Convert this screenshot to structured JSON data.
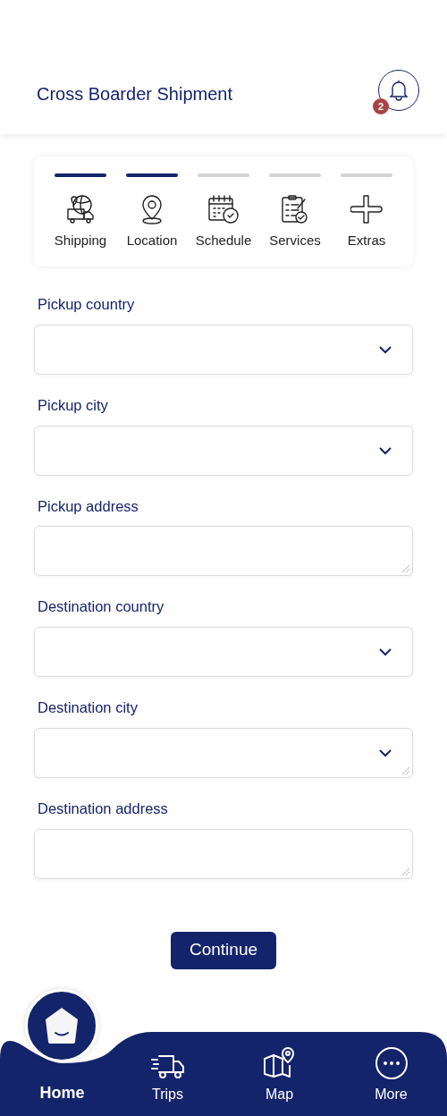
{
  "header": {
    "title": "Cross Boarder Shipment",
    "notification_count": "2"
  },
  "steps": [
    {
      "kind": "shipping",
      "label": "Shipping",
      "done": true
    },
    {
      "kind": "location",
      "label": "Location",
      "done": true
    },
    {
      "kind": "schedule",
      "label": "Schedule",
      "done": false
    },
    {
      "kind": "services",
      "label": "Services",
      "done": false
    },
    {
      "kind": "extras",
      "label": "Extras",
      "done": false
    }
  ],
  "fields": [
    {
      "kind": "select",
      "label": "Pickup country",
      "resizable": false
    },
    {
      "kind": "select",
      "label": "Pickup city",
      "resizable": false
    },
    {
      "kind": "textarea",
      "label": "Pickup address",
      "resizable": true
    },
    {
      "kind": "select",
      "label": "Destination country",
      "resizable": false
    },
    {
      "kind": "select",
      "label": "Destination city",
      "resizable": true
    },
    {
      "kind": "textarea",
      "label": "Destination address",
      "resizable": true
    }
  ],
  "continue_button": "Continue",
  "nav": [
    {
      "kind": "home",
      "label": "Home",
      "selected": true
    },
    {
      "kind": "trips",
      "label": "Trips",
      "selected": false
    },
    {
      "kind": "map",
      "label": "Map",
      "selected": false
    },
    {
      "kind": "more",
      "label": "More",
      "selected": false
    }
  ]
}
